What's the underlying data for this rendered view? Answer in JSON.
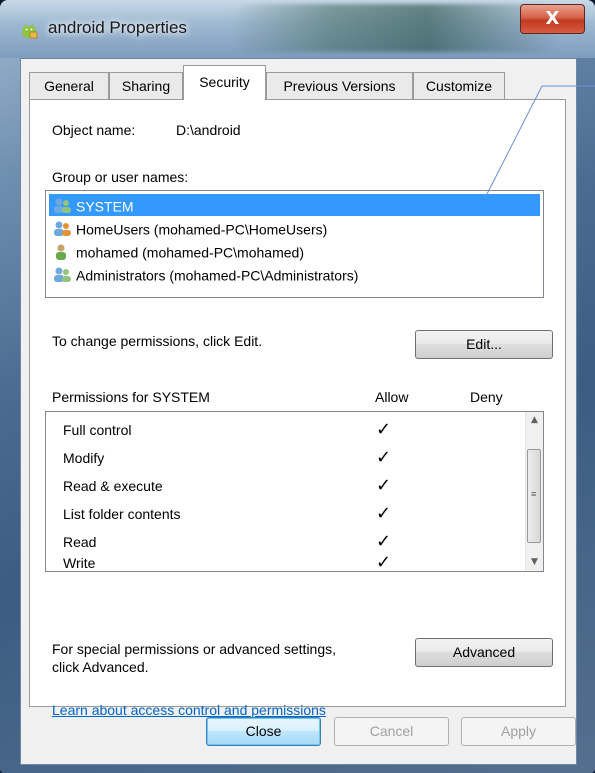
{
  "window": {
    "title": "android Properties",
    "close_glyph": "X"
  },
  "tabs": [
    {
      "label": "General",
      "active": false
    },
    {
      "label": "Sharing",
      "active": false
    },
    {
      "label": "Security",
      "active": true
    },
    {
      "label": "Previous Versions",
      "active": false
    },
    {
      "label": "Customize",
      "active": false
    }
  ],
  "security": {
    "object_name_label": "Object name:",
    "object_name_value": "D:\\android",
    "groups_label": "Group or user names:",
    "groups": [
      {
        "name": "SYSTEM",
        "icon": "users-group-icon",
        "selected": true
      },
      {
        "name": "HomeUsers (mohamed-PC\\HomeUsers)",
        "icon": "users-group-icon",
        "selected": false
      },
      {
        "name": "mohamed (mohamed-PC\\mohamed)",
        "icon": "user-icon",
        "selected": false
      },
      {
        "name": "Administrators (mohamed-PC\\Administrators)",
        "icon": "users-group-icon",
        "selected": false
      }
    ],
    "change_hint": "To change permissions, click Edit.",
    "edit_button": "Edit...",
    "permissions_header": "Permissions for SYSTEM",
    "allow_header": "Allow",
    "deny_header": "Deny",
    "permissions": [
      {
        "name": "Full control",
        "allow": "✓",
        "deny": ""
      },
      {
        "name": "Modify",
        "allow": "✓",
        "deny": ""
      },
      {
        "name": "Read & execute",
        "allow": "✓",
        "deny": ""
      },
      {
        "name": "List folder contents",
        "allow": "✓",
        "deny": ""
      },
      {
        "name": "Read",
        "allow": "✓",
        "deny": ""
      },
      {
        "name": "Write",
        "allow": "✓",
        "deny": ""
      }
    ],
    "advanced_hint_line1": "For special permissions or advanced settings,",
    "advanced_hint_line2": "click Advanced.",
    "advanced_button": "Advanced",
    "learn_link": "Learn about access control and permissions"
  },
  "footer": {
    "close_button": "Close",
    "cancel_button": "Cancel",
    "apply_button": "Apply"
  },
  "colors": {
    "selection": "#3399ff",
    "link": "#0066cc",
    "close_button_red": "#c0391f"
  }
}
